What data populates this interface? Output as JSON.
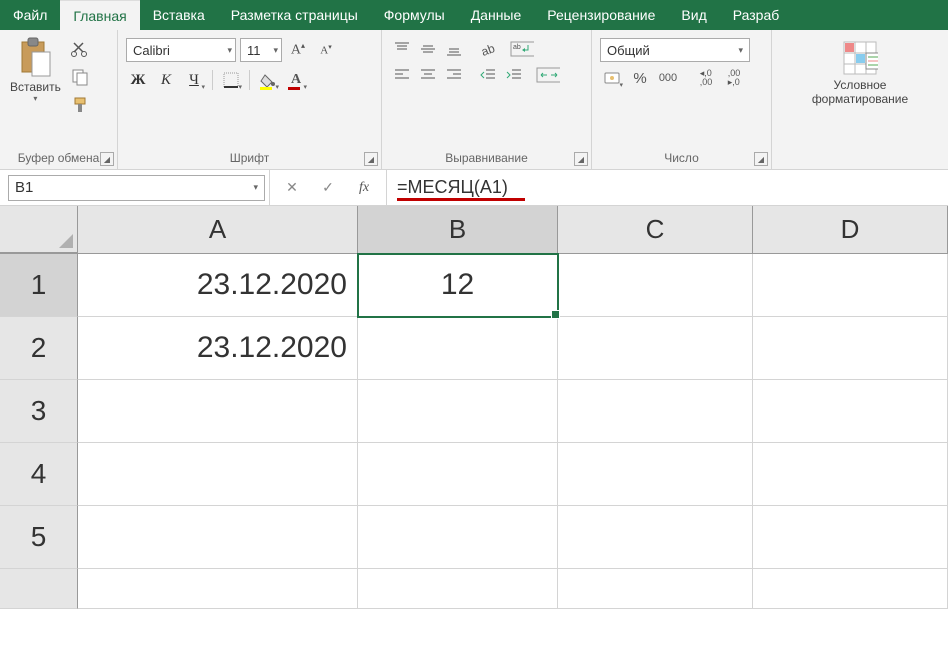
{
  "menu": {
    "items": [
      "Файл",
      "Главная",
      "Вставка",
      "Разметка страницы",
      "Формулы",
      "Данные",
      "Рецензирование",
      "Вид",
      "Разраб"
    ],
    "active_index": 1
  },
  "ribbon": {
    "clipboard": {
      "paste_label": "Вставить",
      "group_label": "Буфер обмена"
    },
    "font": {
      "name": "Calibri",
      "size": "11",
      "bold": "Ж",
      "italic": "К",
      "underline": "Ч",
      "group_label": "Шрифт",
      "highlight_color": "#ffff00",
      "font_color": "#c00000"
    },
    "alignment": {
      "group_label": "Выравнивание"
    },
    "number": {
      "format": "Общий",
      "group_label": "Число"
    },
    "cond": {
      "label1": "Условное",
      "label2": "форматирование"
    }
  },
  "formula_bar": {
    "name_box": "B1",
    "formula": "=МЕСЯЦ(A1)",
    "fx_label": "fx"
  },
  "grid": {
    "columns": [
      "A",
      "B",
      "C",
      "D"
    ],
    "selected_col": "B",
    "rows": [
      "1",
      "2",
      "3",
      "4",
      "5"
    ],
    "selected_row": "1",
    "selected_cell": "B1",
    "cells": {
      "A1": "23.12.2020",
      "B1": "12",
      "A2": "23.12.2020"
    }
  }
}
